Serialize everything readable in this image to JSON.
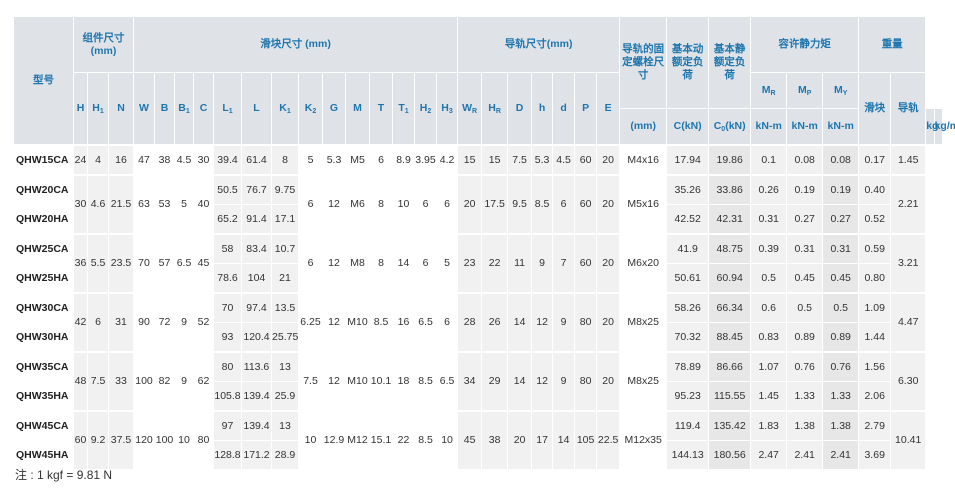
{
  "headers": {
    "model": "型号",
    "assembly": "组件尺寸 (mm)",
    "block": "滑块尺寸 (mm)",
    "rail": "导轨尺寸(mm)",
    "bolt": "导轨的固定螺栓尺寸",
    "dyn_load": "基本动额定负荷",
    "static_load": "基本静额定负荷",
    "moment": "容许静力矩",
    "weight": "重量",
    "bolt_unit": "(mm)",
    "dyn_unit": "C(kN)",
    "static_unit": "C0(kN)",
    "moment_unit": "kN-m",
    "weight_block": "滑块",
    "weight_rail": "导轨",
    "weight_block_unit": "kg",
    "weight_rail_unit": "kg/m"
  },
  "columns": [
    "H",
    "H1",
    "N",
    "W",
    "B",
    "B1",
    "C",
    "L1",
    "L",
    "K1",
    "K2",
    "G",
    "M",
    "T",
    "T1",
    "H2",
    "H3",
    "WR",
    "HR",
    "D",
    "h",
    "d",
    "P",
    "E",
    "MR",
    "MP",
    "MY"
  ],
  "groups": [
    {
      "rows": [
        {
          "model": "QHW15CA",
          "L1": "39.4",
          "L": "61.4",
          "K1": "8",
          "C": "17.94",
          "C0": "19.86",
          "MR": "0.1",
          "MP": "0.08",
          "MY": "0.08",
          "block_kg": "0.17"
        }
      ],
      "shared": {
        "H": "24",
        "H1": "4",
        "N": "16",
        "W": "47",
        "B": "38",
        "B1": "4.5",
        "Cdim": "30",
        "K2": "5",
        "G": "5.3",
        "M": "M5",
        "T": "6",
        "T1": "8.9",
        "H2": "3.95",
        "H3": "4.2",
        "WR": "15",
        "HR": "15",
        "D": "7.5",
        "h": "5.3",
        "d": "4.5",
        "P": "60",
        "E": "20",
        "bolt": "M4x16",
        "rail_kgm": "1.45"
      }
    },
    {
      "rows": [
        {
          "model": "QHW20CA",
          "L1": "50.5",
          "L": "76.7",
          "K1": "9.75",
          "C": "35.26",
          "C0": "33.86",
          "MR": "0.26",
          "MP": "0.19",
          "MY": "0.19",
          "block_kg": "0.40"
        },
        {
          "model": "QHW20HA",
          "L1": "65.2",
          "L": "91.4",
          "K1": "17.1",
          "C": "42.52",
          "C0": "42.31",
          "MR": "0.31",
          "MP": "0.27",
          "MY": "0.27",
          "block_kg": "0.52"
        }
      ],
      "shared": {
        "H": "30",
        "H1": "4.6",
        "N": "21.5",
        "W": "63",
        "B": "53",
        "B1": "5",
        "Cdim": "40",
        "K2": "6",
        "G": "12",
        "M": "M6",
        "T": "8",
        "T1": "10",
        "H2": "6",
        "H3": "6",
        "WR": "20",
        "HR": "17.5",
        "D": "9.5",
        "h": "8.5",
        "d": "6",
        "P": "60",
        "E": "20",
        "bolt": "M5x16",
        "rail_kgm": "2.21"
      }
    },
    {
      "rows": [
        {
          "model": "QHW25CA",
          "L1": "58",
          "L": "83.4",
          "K1": "10.7",
          "C": "41.9",
          "C0": "48.75",
          "MR": "0.39",
          "MP": "0.31",
          "MY": "0.31",
          "block_kg": "0.59"
        },
        {
          "model": "QHW25HA",
          "L1": "78.6",
          "L": "104",
          "K1": "21",
          "C": "50.61",
          "C0": "60.94",
          "MR": "0.5",
          "MP": "0.45",
          "MY": "0.45",
          "block_kg": "0.80"
        }
      ],
      "shared": {
        "H": "36",
        "H1": "5.5",
        "N": "23.5",
        "W": "70",
        "B": "57",
        "B1": "6.5",
        "Cdim": "45",
        "K2": "6",
        "G": "12",
        "M": "M8",
        "T": "8",
        "T1": "14",
        "H2": "6",
        "H3": "5",
        "WR": "23",
        "HR": "22",
        "D": "11",
        "h": "9",
        "d": "7",
        "P": "60",
        "E": "20",
        "bolt": "M6x20",
        "rail_kgm": "3.21"
      }
    },
    {
      "rows": [
        {
          "model": "QHW30CA",
          "L1": "70",
          "L": "97.4",
          "K1": "13.5",
          "C": "58.26",
          "C0": "66.34",
          "MR": "0.6",
          "MP": "0.5",
          "MY": "0.5",
          "block_kg": "1.09"
        },
        {
          "model": "QHW30HA",
          "L1": "93",
          "L": "120.4",
          "K1": "25.75",
          "C": "70.32",
          "C0": "88.45",
          "MR": "0.83",
          "MP": "0.89",
          "MY": "0.89",
          "block_kg": "1.44"
        }
      ],
      "shared": {
        "H": "42",
        "H1": "6",
        "N": "31",
        "W": "90",
        "B": "72",
        "B1": "9",
        "Cdim": "52",
        "K2": "6.25",
        "G": "12",
        "M": "M10",
        "T": "8.5",
        "T1": "16",
        "H2": "6.5",
        "H3": "6",
        "WR": "28",
        "HR": "26",
        "D": "14",
        "h": "12",
        "d": "9",
        "P": "80",
        "E": "20",
        "bolt": "M8x25",
        "rail_kgm": "4.47"
      }
    },
    {
      "rows": [
        {
          "model": "QHW35CA",
          "L1": "80",
          "L": "113.6",
          "K1": "13",
          "C": "78.89",
          "C0": "86.66",
          "MR": "1.07",
          "MP": "0.76",
          "MY": "0.76",
          "block_kg": "1.56"
        },
        {
          "model": "QHW35HA",
          "L1": "105.8",
          "L": "139.4",
          "K1": "25.9",
          "C": "95.23",
          "C0": "115.55",
          "MR": "1.45",
          "MP": "1.33",
          "MY": "1.33",
          "block_kg": "2.06"
        }
      ],
      "shared": {
        "H": "48",
        "H1": "7.5",
        "N": "33",
        "W": "100",
        "B": "82",
        "B1": "9",
        "Cdim": "62",
        "K2": "7.5",
        "G": "12",
        "M": "M10",
        "T": "10.1",
        "T1": "18",
        "H2": "8.5",
        "H3": "6.5",
        "WR": "34",
        "HR": "29",
        "D": "14",
        "h": "12",
        "d": "9",
        "P": "80",
        "E": "20",
        "bolt": "M8x25",
        "rail_kgm": "6.30"
      }
    },
    {
      "rows": [
        {
          "model": "QHW45CA",
          "L1": "97",
          "L": "139.4",
          "K1": "13",
          "C": "119.4",
          "C0": "135.42",
          "MR": "1.83",
          "MP": "1.38",
          "MY": "1.38",
          "block_kg": "2.79"
        },
        {
          "model": "QHW45HA",
          "L1": "128.8",
          "L": "171.2",
          "K1": "28.9",
          "C": "144.13",
          "C0": "180.56",
          "MR": "2.47",
          "MP": "2.41",
          "MY": "2.41",
          "block_kg": "3.69"
        }
      ],
      "shared": {
        "H": "60",
        "H1": "9.2",
        "N": "37.5",
        "W": "120",
        "B": "100",
        "B1": "10",
        "Cdim": "80",
        "K2": "10",
        "G": "12.9",
        "M": "M12",
        "T": "15.1",
        "T1": "22",
        "H2": "8.5",
        "H3": "10",
        "WR": "45",
        "HR": "38",
        "D": "20",
        "h": "17",
        "d": "14",
        "P": "105",
        "E": "22.5",
        "bolt": "M12x35",
        "rail_kgm": "10.41"
      }
    }
  ],
  "note": "注 : 1 kgf = 9.81 N"
}
